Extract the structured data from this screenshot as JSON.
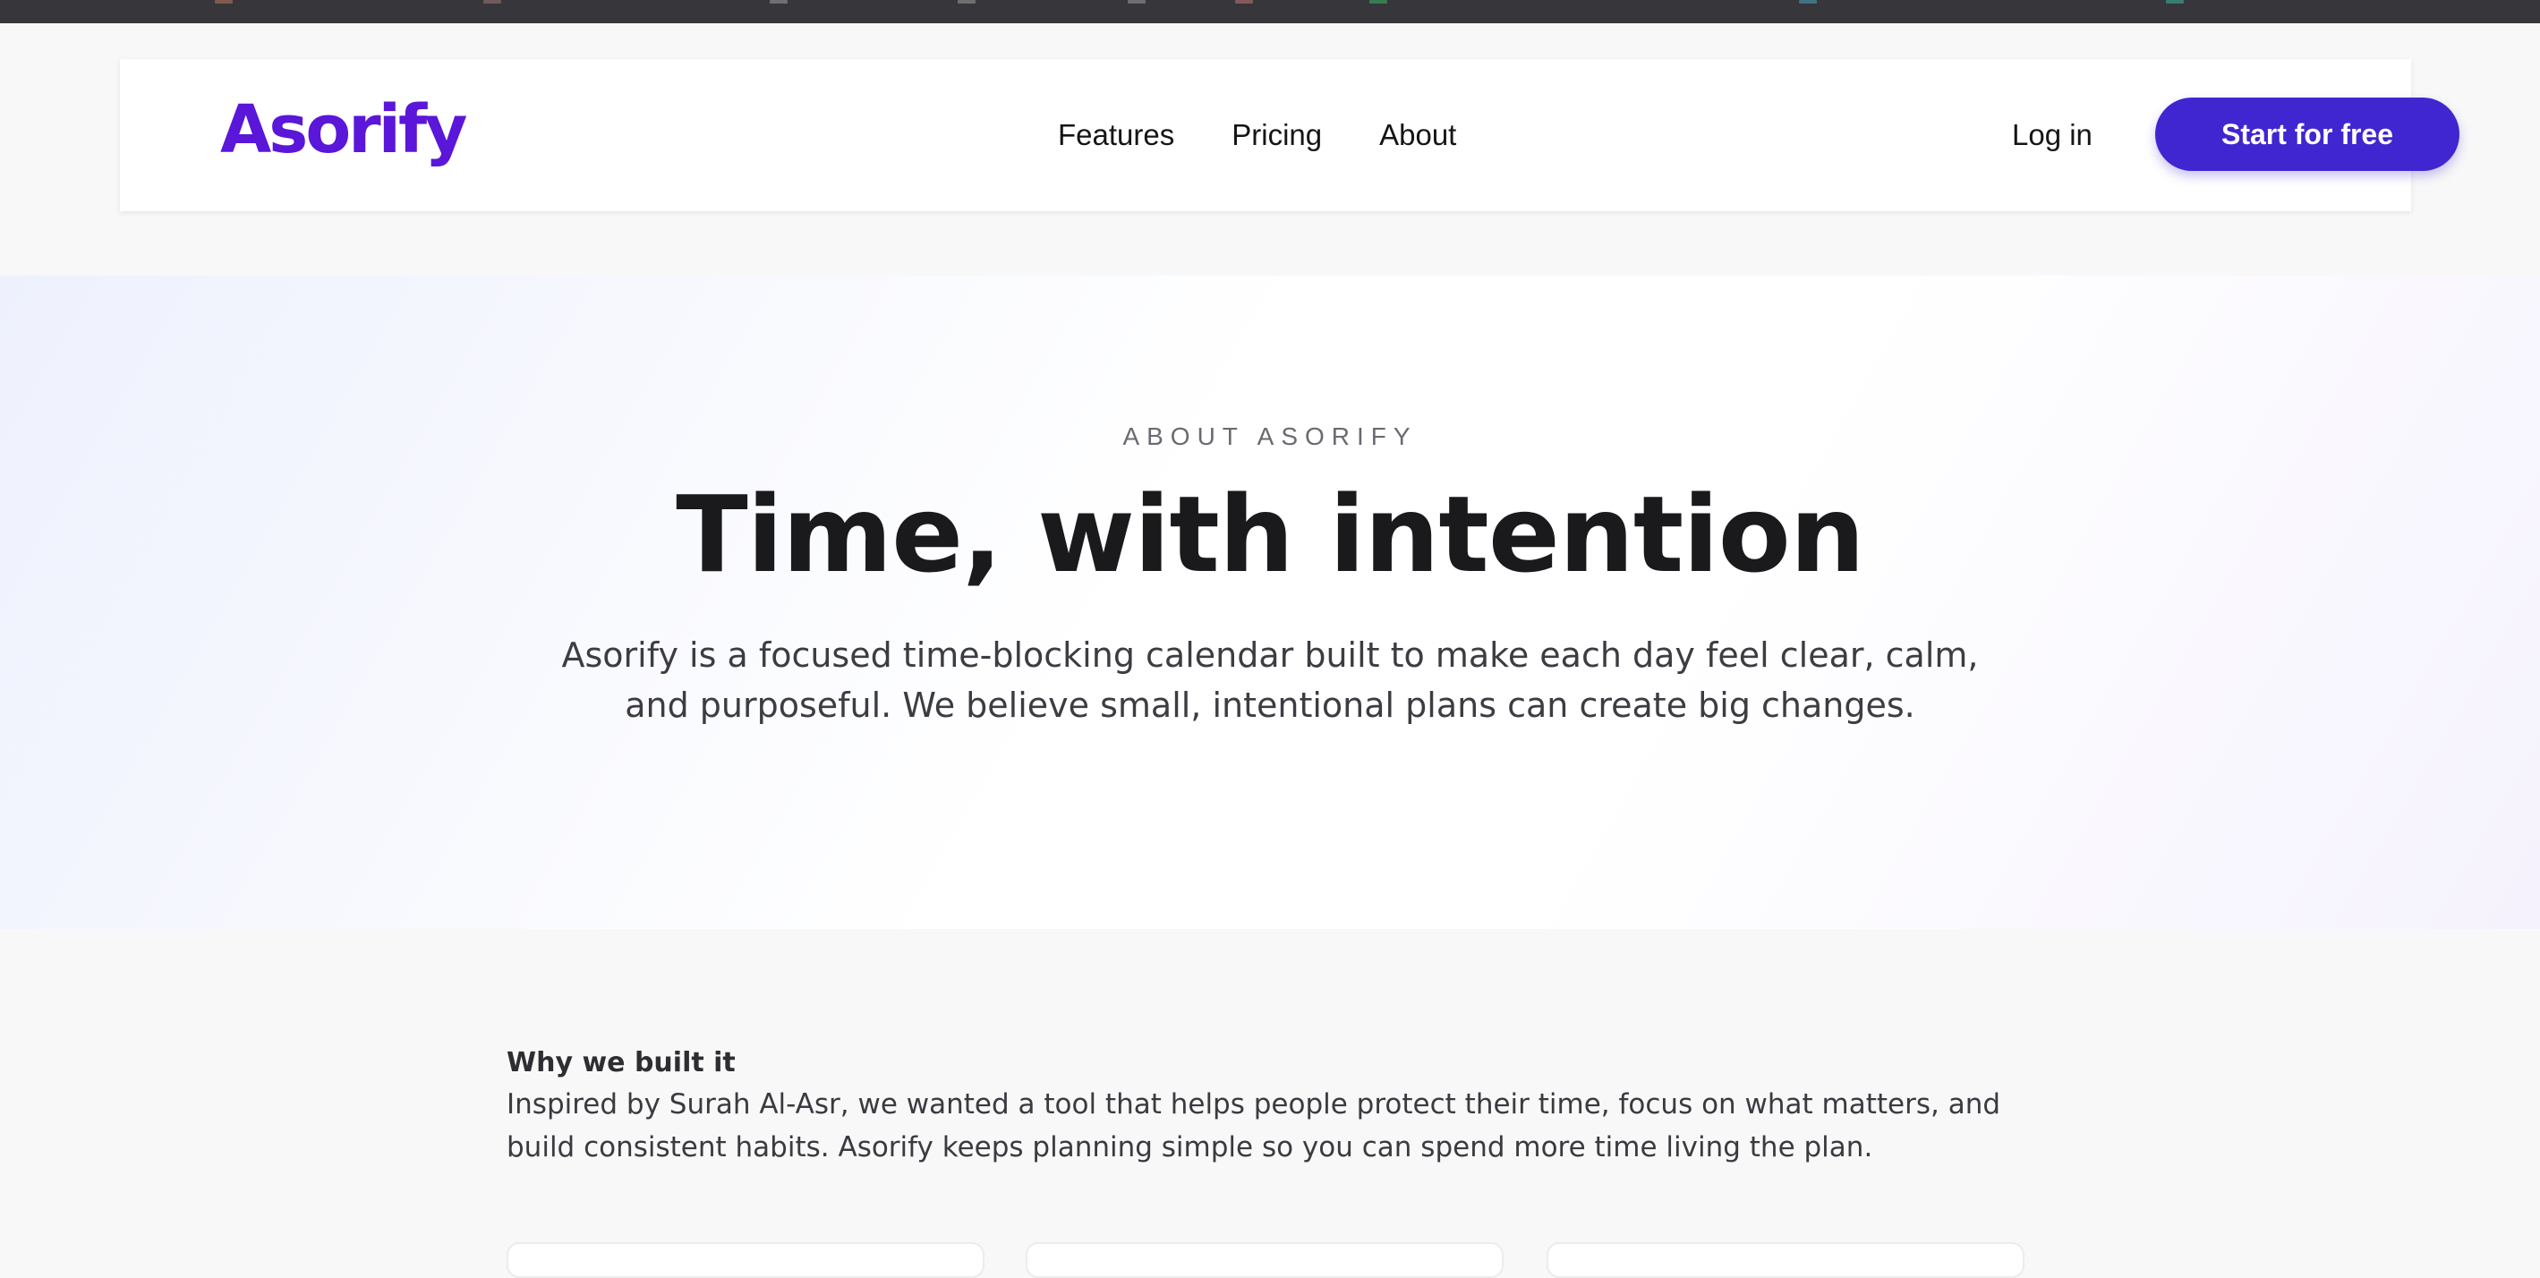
{
  "nav": {
    "logo": "Asorify",
    "links": [
      "Features",
      "Pricing",
      "About"
    ],
    "login": "Log in",
    "cta": "Start for free"
  },
  "hero": {
    "eyebrow": "ABOUT ASORIFY",
    "title": "Time, with intention",
    "description": "Asorify is a focused time-blocking calendar built to make each day feel clear, calm, and purposeful. We believe small, intentional plans can create big changes."
  },
  "about": {
    "heading": "Why we built it",
    "body": "Inspired by Surah Al-Asr, we wanted a tool that helps people protect their time, focus on what matters, and build consistent habits. Asorify keeps planning simple so you can spend more time living the plan."
  },
  "colors": {
    "brand": "#5a16d9",
    "cta": "#4026d0"
  }
}
